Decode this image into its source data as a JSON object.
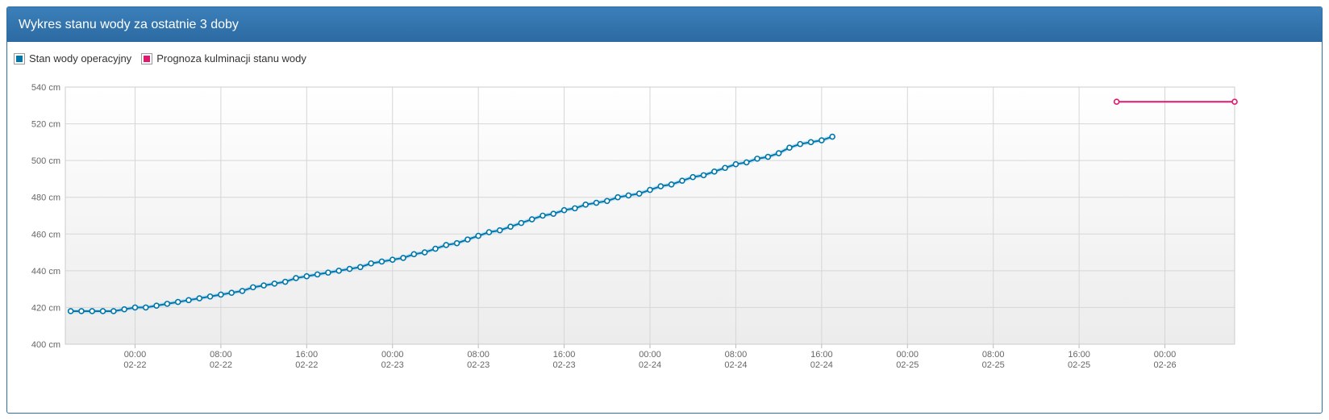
{
  "header": {
    "title": "Wykres stanu wody za ostatnie 3 doby"
  },
  "legend": [
    {
      "label": "Stan wody operacyjny",
      "color": "#0077aa"
    },
    {
      "label": "Prognoza kulminacji stanu wody",
      "color": "#e0196e"
    }
  ],
  "chart_data": {
    "type": "line",
    "y_ticks": [
      "540 cm",
      "520 cm",
      "500 cm",
      "480 cm",
      "460 cm",
      "440 cm",
      "420 cm",
      "400 cm"
    ],
    "ylim": [
      400,
      540
    ],
    "x_ticks": [
      {
        "time": "00:00",
        "date": "02-22"
      },
      {
        "time": "08:00",
        "date": "02-22"
      },
      {
        "time": "16:00",
        "date": "02-22"
      },
      {
        "time": "00:00",
        "date": "02-23"
      },
      {
        "time": "08:00",
        "date": "02-23"
      },
      {
        "time": "16:00",
        "date": "02-23"
      },
      {
        "time": "00:00",
        "date": "02-24"
      },
      {
        "time": "08:00",
        "date": "02-24"
      },
      {
        "time": "16:00",
        "date": "02-24"
      },
      {
        "time": "00:00",
        "date": "02-25"
      },
      {
        "time": "08:00",
        "date": "02-25"
      },
      {
        "time": "16:00",
        "date": "02-25"
      },
      {
        "time": "00:00",
        "date": "02-26"
      }
    ],
    "xlim_hours": [
      -6.5,
      102.5
    ],
    "grid": true,
    "series": [
      {
        "name": "Stan wody operacyjny",
        "color": "#0077aa",
        "start_hour": -6,
        "step_hours": 1,
        "values": [
          418,
          418,
          418,
          418,
          418,
          419,
          420,
          420,
          421,
          422,
          423,
          424,
          425,
          426,
          427,
          428,
          429,
          431,
          432,
          433,
          434,
          436,
          437,
          438,
          439,
          440,
          441,
          442,
          444,
          445,
          446,
          447,
          449,
          450,
          452,
          454,
          455,
          457,
          459,
          461,
          462,
          464,
          466,
          468,
          470,
          471,
          473,
          474,
          476,
          477,
          478,
          480,
          481,
          482,
          484,
          486,
          487,
          489,
          491,
          492,
          494,
          496,
          498,
          499,
          501,
          502,
          504,
          507,
          509,
          510,
          511,
          513
        ]
      },
      {
        "name": "Prognoza kulminacji stanu wody",
        "color": "#e0196e",
        "x_hours": [
          91.5,
          102.5
        ],
        "values": [
          532,
          532
        ]
      }
    ]
  }
}
